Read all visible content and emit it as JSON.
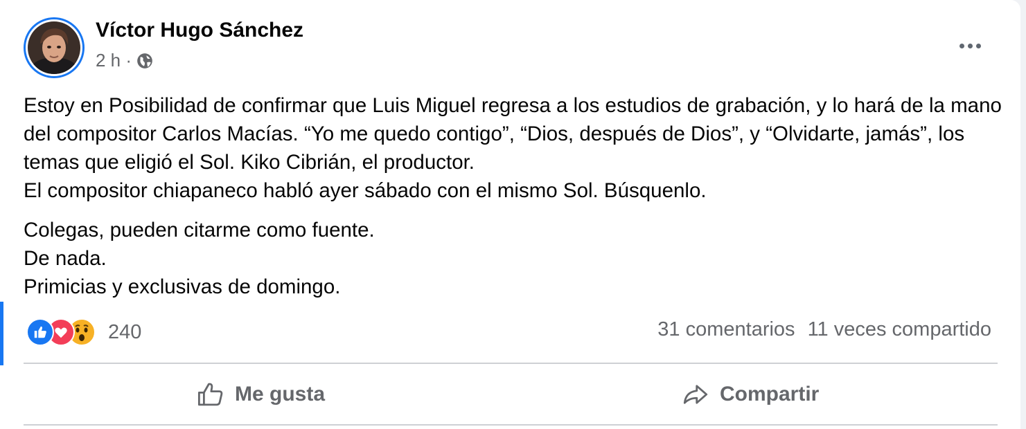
{
  "post": {
    "author": "Víctor Hugo Sánchez",
    "time": "2 h ·",
    "privacy_icon": "globe-icon",
    "menu_icon": "more-options-icon",
    "paragraphs": [
      "Estoy en Posibilidad de confirmar que Luis Miguel regresa a los estudios de grabación, y lo hará de la mano del compositor Carlos Macías. “Yo me quedo contigo”, “Dios, después de Dios”, y “Olvidarte, jamás”, los temas que eligió el Sol. Kiko Cibrián, el productor.",
      "El compositor chiapaneco habló ayer sábado con el mismo Sol. Búsquenlo.",
      "Colegas, pueden citarme como fuente.",
      "De nada.",
      "Primicias y exclusivas de domingo."
    ]
  },
  "reactions": {
    "icons": [
      "like-reaction-icon",
      "love-reaction-icon",
      "wow-reaction-icon"
    ],
    "count": "240"
  },
  "stats": {
    "comments": "31 comentarios",
    "shares": "11 veces compartido"
  },
  "actions": {
    "like_label": "Me gusta",
    "like_icon": "thumbs-up-icon",
    "share_label": "Compartir",
    "share_icon": "share-arrow-icon"
  },
  "colors": {
    "accent": "#1877f2",
    "text": "#050505",
    "secondary_text": "#65676b",
    "love": "#f33e58",
    "wow": "#f7b125"
  }
}
